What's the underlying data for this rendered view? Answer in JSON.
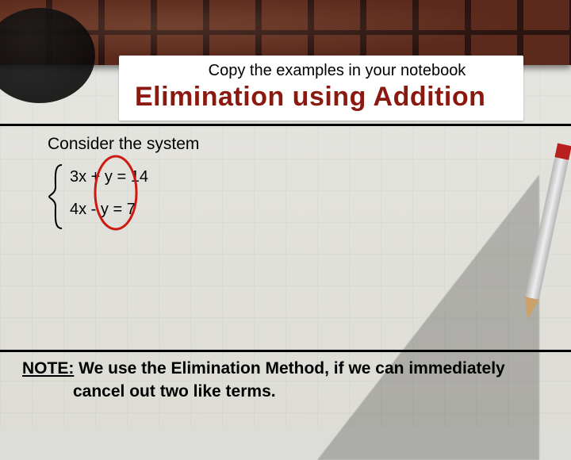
{
  "header": {
    "subtitle": "Copy the examples in your notebook",
    "title": "Elimination using Addition"
  },
  "body": {
    "consider": "Consider the system",
    "eq1": "3x + y = 14",
    "eq2": "4x - y = 7"
  },
  "note": {
    "label": "NOTE:",
    "line1": " We use the Elimination Method, if we can immediately",
    "line2": "cancel out two like terms."
  }
}
